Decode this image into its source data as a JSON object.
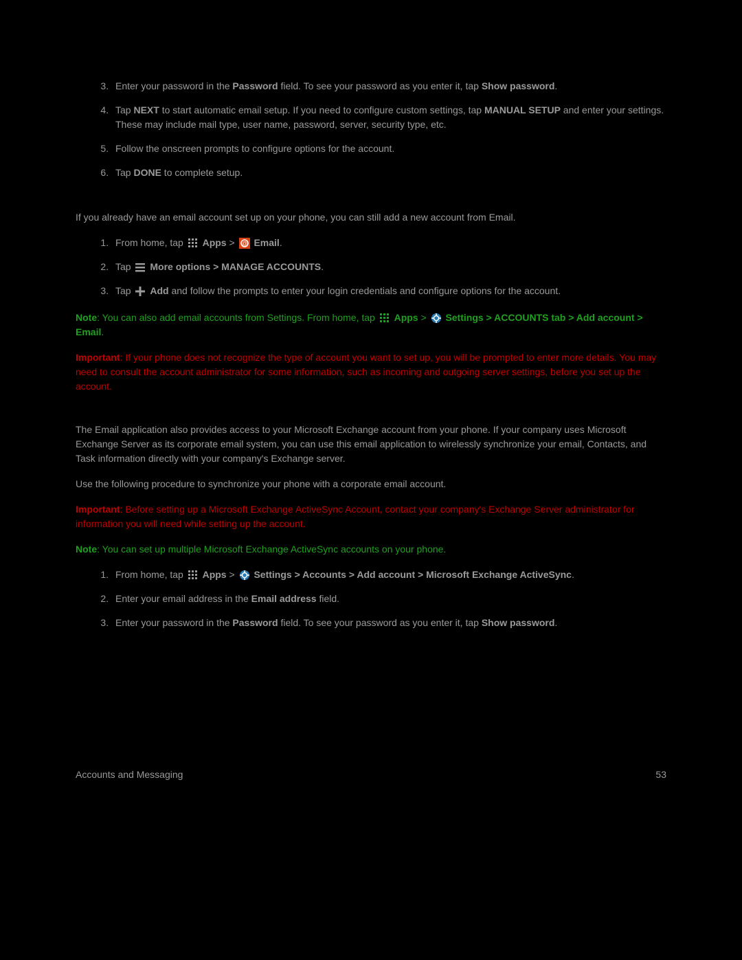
{
  "list1": {
    "start": 3,
    "item3_a": "Enter your password in the ",
    "item3_b": "Password",
    "item3_c": " field. To see your password as you enter it, tap ",
    "item3_d": "Show password",
    "item3_e": ".",
    "item4_a": "Tap ",
    "item4_b": "NEXT",
    "item4_c": " to start automatic email setup. If you need to configure custom settings, tap ",
    "item4_d": "MANUAL SETUP",
    "item4_e": " and enter your settings. These may include mail type, user name, password, server, security type, etc.",
    "item5": "Follow the onscreen prompts to configure options for the account.",
    "item6_a": "Tap ",
    "item6_b": "DONE",
    "item6_c": " to complete setup."
  },
  "para1": "If you already have an email account set up on your phone, you can still add a new account from Email.",
  "list2": {
    "item1_a": "From home, tap ",
    "item1_apps": " Apps",
    "item1_gt": " > ",
    "item1_email": " Email",
    "item1_end": ".",
    "item2_a": "Tap ",
    "item2_b": " More options > MANAGE ACCOUNTS",
    "item2_c": ".",
    "item3_a": "Tap ",
    "item3_b": " Add",
    "item3_c": " and follow the prompts to enter your login credentials and configure options for the account."
  },
  "note1": {
    "label": "Note",
    "a": ": You can also add email accounts from Settings. From home, tap ",
    "apps": " Apps",
    "gt1": " > ",
    "settings": " Settings",
    "rest": " > ACCOUNTS tab > Add account > Email",
    "end": "."
  },
  "important1": {
    "label": "Important",
    "text": ": If your phone does not recognize the type of account you want to set up, you will be prompted to enter more details. You may need to consult the account administrator for some information, such as incoming and outgoing server settings, before you set up the account."
  },
  "para2": "The Email application also provides access to your Microsoft Exchange account from your phone. If your company uses Microsoft Exchange Server as its corporate email system, you can use this email application to wirelessly synchronize your email, Contacts, and Task information directly with your company's Exchange server.",
  "para3": "Use the following procedure to synchronize your phone with a corporate email account.",
  "important2": {
    "label": "Important",
    "text": ": Before setting up a Microsoft Exchange ActiveSync Account, contact your company's Exchange Server administrator for information you will need while setting up the account."
  },
  "note2": {
    "label": "Note",
    "text": ": You can set up multiple Microsoft Exchange ActiveSync accounts on your phone."
  },
  "list3": {
    "item1_a": "From home, tap ",
    "item1_apps": " Apps",
    "item1_gt": " > ",
    "item1_settings": " Settings > Accounts > Add account > Microsoft Exchange ActiveSync",
    "item1_end": ".",
    "item2_a": "Enter your email address in the ",
    "item2_b": "Email address",
    "item2_c": " field.",
    "item3_a": "Enter your password in the ",
    "item3_b": "Password",
    "item3_c": " field. To see your password as you enter it, tap ",
    "item3_d": "Show password",
    "item3_e": "."
  },
  "footer": {
    "left": "Accounts and Messaging",
    "right": "53"
  }
}
